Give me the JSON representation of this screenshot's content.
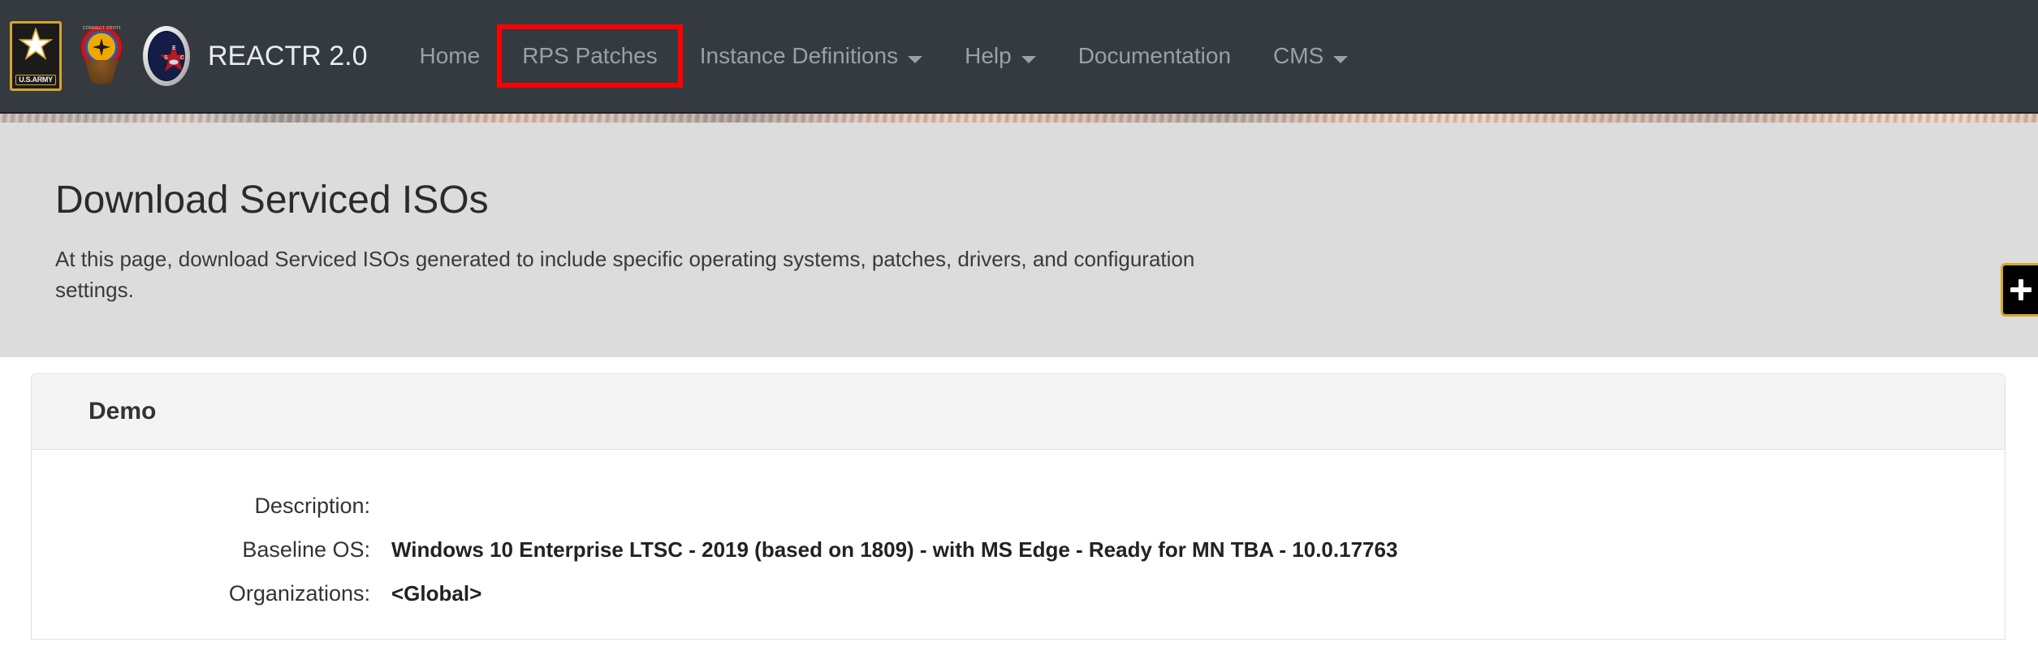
{
  "navbar": {
    "brand_title": "REACTR 2.0",
    "logos": [
      {
        "name": "us-army-logo",
        "label": "U.S.ARMY"
      },
      {
        "name": "cecom-crest-logo",
        "label": "CONNECT PROTECT PROJECT"
      },
      {
        "name": "sec-seal-logo",
        "letters": {
          "top": "E",
          "left": "S",
          "right": "C"
        }
      }
    ],
    "items": [
      {
        "label": "Home",
        "name": "nav-home",
        "caret": false,
        "highlighted": false
      },
      {
        "label": "RPS Patches",
        "name": "nav-rps-patches",
        "caret": false,
        "highlighted": true
      },
      {
        "label": "Instance Definitions",
        "name": "nav-instance-definitions",
        "caret": true,
        "highlighted": false
      },
      {
        "label": "Help",
        "name": "nav-help",
        "caret": true,
        "highlighted": false
      },
      {
        "label": "Documentation",
        "name": "nav-documentation",
        "caret": false,
        "highlighted": false
      },
      {
        "label": "CMS",
        "name": "nav-cms",
        "caret": true,
        "highlighted": false
      }
    ],
    "highlight_color": "#ff0000",
    "background_color": "#343a40",
    "link_color": "#9aa0a6"
  },
  "jumbotron": {
    "title": "Download Serviced ISOs",
    "description": "At this page, download Serviced ISOs generated to include specific operating systems, patches, drivers, and configuration settings.",
    "background_color": "#dcdcdc"
  },
  "panel": {
    "title": "Demo",
    "details": [
      {
        "label": "Description:",
        "value": ""
      },
      {
        "label": "Baseline OS:",
        "value": "Windows 10 Enterprise LTSC - 2019 (based on 1809) - with MS Edge - Ready for MN TBA - 10.0.17763"
      },
      {
        "label": "Organizations:",
        "value": "<Global>"
      }
    ]
  },
  "fab": {
    "name": "add-button",
    "glyph": "+",
    "accent_color": "#d4a72c"
  }
}
